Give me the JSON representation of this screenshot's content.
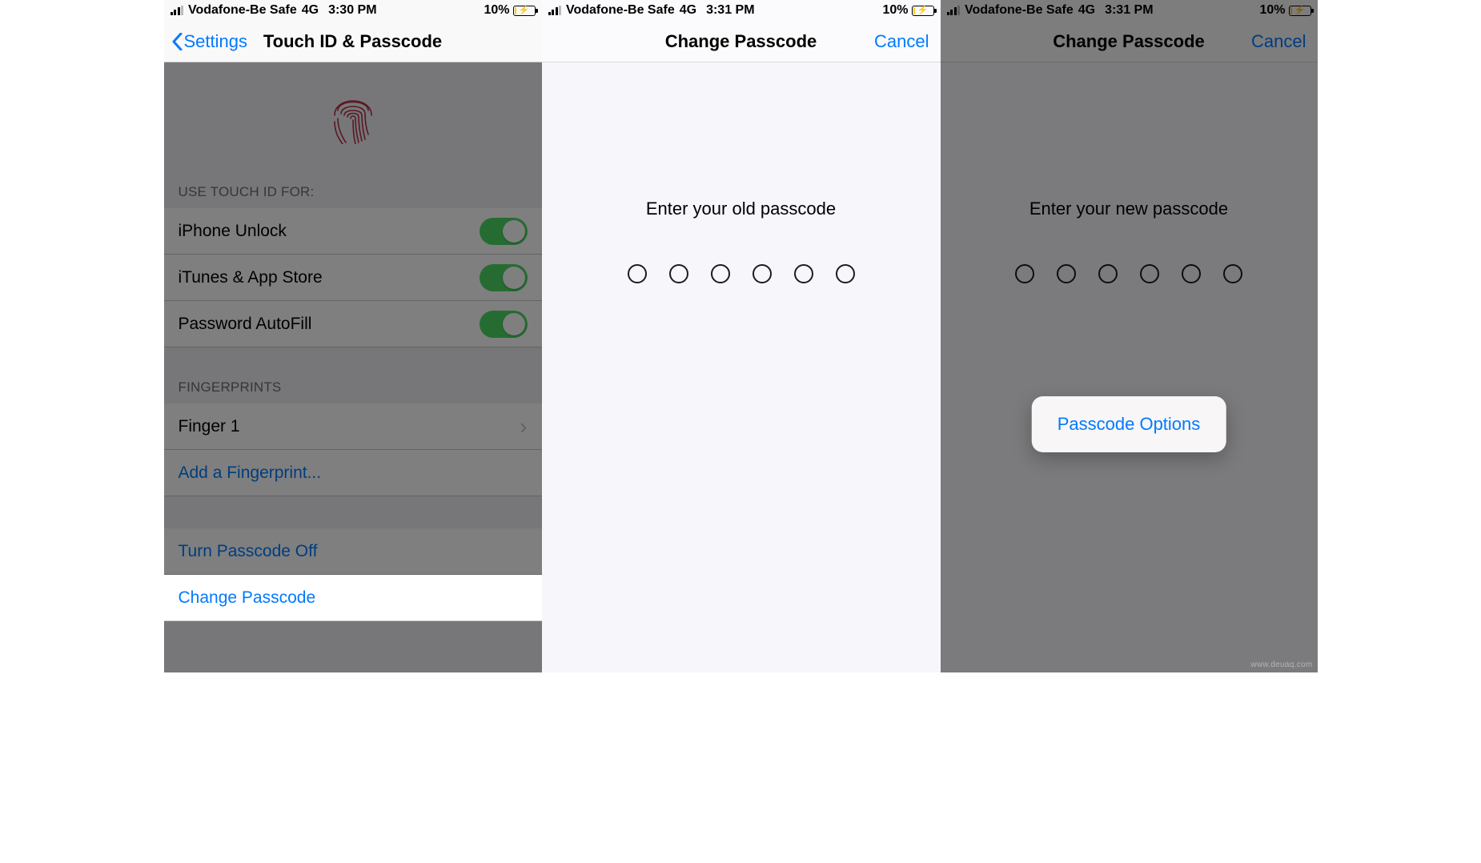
{
  "status": {
    "carrier": "Vodafone-Be Safe",
    "network": "4G",
    "battery_pct": "10%"
  },
  "times": {
    "p1": "3:30 PM",
    "p2": "3:31 PM",
    "p3": "3:31 PM"
  },
  "panel1": {
    "back_label": "Settings",
    "title": "Touch ID & Passcode",
    "section_use": "USE TOUCH ID FOR:",
    "rows": {
      "iphone_unlock": "iPhone Unlock",
      "itunes": "iTunes & App Store",
      "autofill": "Password AutoFill"
    },
    "section_fp": "FINGERPRINTS",
    "finger1": "Finger 1",
    "add_fp": "Add a Fingerprint...",
    "turn_off": "Turn Passcode Off",
    "change": "Change Passcode"
  },
  "panel2": {
    "title": "Change Passcode",
    "cancel": "Cancel",
    "prompt": "Enter your old passcode"
  },
  "panel3": {
    "title": "Change Passcode",
    "cancel": "Cancel",
    "prompt": "Enter your new passcode",
    "options": "Passcode Options"
  },
  "watermark": "www.deuaq.com"
}
